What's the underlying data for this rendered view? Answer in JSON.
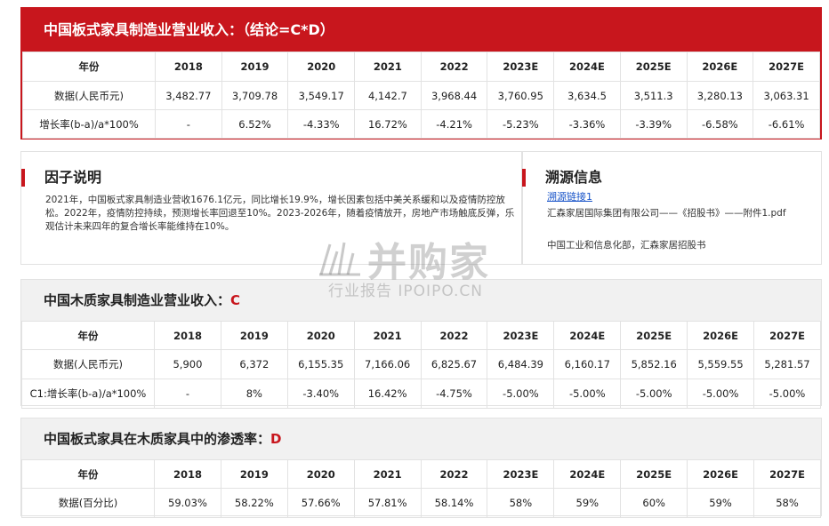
{
  "main": {
    "title": "中国板式家具制造业营业收入：（结论=C*D）",
    "header_label": "年份",
    "years": [
      "2018",
      "2019",
      "2020",
      "2021",
      "2022",
      "2023E",
      "2024E",
      "2025E",
      "2026E",
      "2027E"
    ],
    "rows": [
      {
        "label": "数据(人民币元)",
        "values": [
          "3,482.77",
          "3,709.78",
          "3,549.17",
          "4,142.7",
          "3,968.44",
          "3,760.95",
          "3,634.5",
          "3,511.3",
          "3,280.13",
          "3,063.31"
        ]
      },
      {
        "label": "增长率(b-a)/a*100%",
        "values": [
          "-",
          "6.52%",
          "-4.33%",
          "16.72%",
          "-4.21%",
          "-5.23%",
          "-3.36%",
          "-3.39%",
          "-6.58%",
          "-6.61%"
        ]
      }
    ]
  },
  "factor": {
    "title": "因子说明",
    "text": "2021年，中国板式家具制造业营收1676.1亿元，同比增长19.9%，增长因素包括中美关系缓和以及疫情防控放松。2022年，疫情防控持续，预测增长率回退至10%。2023-2026年，随着疫情放开，房地产市场触底反弹，乐观估计未来四年的复合增长率能维持在10%。"
  },
  "source": {
    "title": "溯源信息",
    "link": "溯源链接1",
    "line1": "汇森家居国际集团有限公司——《招股书》——附件1.pdf",
    "line2": "中国工业和信息化部，汇森家居招股书"
  },
  "wood": {
    "title": "中国木质家具制造业营业收入：",
    "code": "C",
    "header_label": "年份",
    "years": [
      "2018",
      "2019",
      "2020",
      "2021",
      "2022",
      "2023E",
      "2024E",
      "2025E",
      "2026E",
      "2027E"
    ],
    "rows": [
      {
        "label": "数据(人民币元)",
        "values": [
          "5,900",
          "6,372",
          "6,155.35",
          "7,166.06",
          "6,825.67",
          "6,484.39",
          "6,160.17",
          "5,852.16",
          "5,559.55",
          "5,281.57"
        ]
      },
      {
        "label": "C1:增长率(b-a)/a*100%",
        "values": [
          "-",
          "8%",
          "-3.40%",
          "16.42%",
          "-4.75%",
          "-5.00%",
          "-5.00%",
          "-5.00%",
          "-5.00%",
          "-5.00%"
        ]
      }
    ]
  },
  "penetration": {
    "title": "中国板式家具在木质家具中的渗透率：",
    "code": "D",
    "header_label": "年份",
    "years": [
      "2018",
      "2019",
      "2020",
      "2021",
      "2022",
      "2023E",
      "2024E",
      "2025E",
      "2026E",
      "2027E"
    ],
    "rows": [
      {
        "label": "数据(百分比)",
        "values": [
          "59.03%",
          "58.22%",
          "57.66%",
          "57.81%",
          "58.14%",
          "58%",
          "59%",
          "60%",
          "59%",
          "58%"
        ]
      }
    ]
  },
  "watermark": {
    "brand": "并购家",
    "sub": "行业报告 IPOIPO.CN"
  },
  "colors": {
    "accent": "#c8161d",
    "link": "#1a55c9"
  }
}
